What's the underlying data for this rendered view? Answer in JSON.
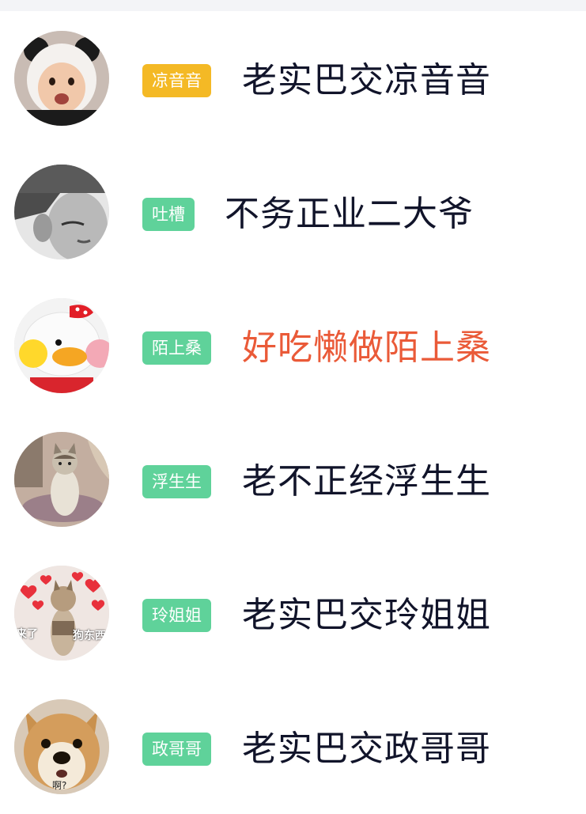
{
  "colors": {
    "badge_yellow": "#f4b925",
    "badge_green": "#5fd29a",
    "name_default": "#11142a",
    "name_highlight": "#ea5a38"
  },
  "entries": [
    {
      "avatar_icon": "panda-hood-baby-avatar",
      "badge": "凉音音",
      "badge_color": "#f4b925",
      "name": "老实巴交凉音音",
      "name_color": "#11142a"
    },
    {
      "avatar_icon": "man-beanie-bw-avatar",
      "badge": "吐槽",
      "badge_color": "#5fd29a",
      "name": "不务正业二大爷",
      "name_color": "#11142a"
    },
    {
      "avatar_icon": "yellow-duck-plush-avatar",
      "badge": "陌上桑",
      "badge_color": "#5fd29a",
      "name": "好吃懒做陌上桑",
      "name_color": "#ea5a38"
    },
    {
      "avatar_icon": "sitting-cat-avatar",
      "badge": "浮生生",
      "badge_color": "#5fd29a",
      "name": "老不正经浮生生",
      "name_color": "#11142a"
    },
    {
      "avatar_icon": "dog-hearts-meme-avatar",
      "avatar_text_left": "来了",
      "avatar_text_right": "狗东西",
      "badge": "玲姐姐",
      "badge_color": "#5fd29a",
      "name": "老实巴交玲姐姐",
      "name_color": "#11142a"
    },
    {
      "avatar_icon": "shiba-dog-meme-avatar",
      "avatar_text_bottom": "啊?",
      "badge": "政哥哥",
      "badge_color": "#5fd29a",
      "name": "老实巴交政哥哥",
      "name_color": "#11142a"
    }
  ]
}
